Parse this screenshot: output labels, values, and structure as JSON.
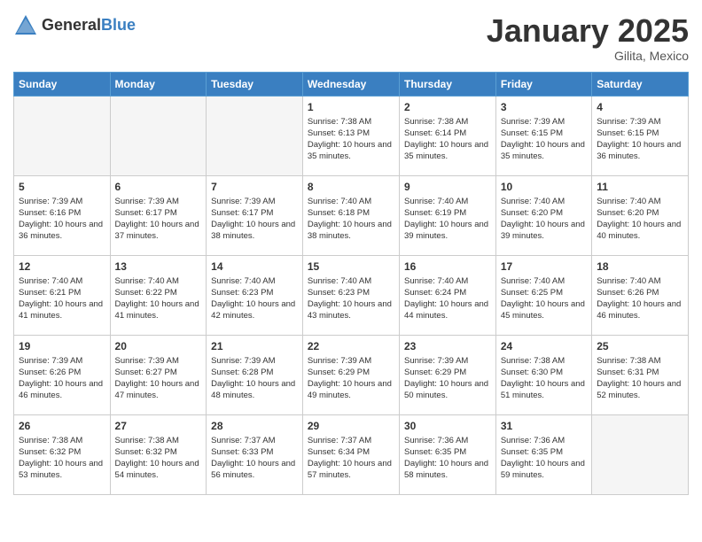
{
  "header": {
    "logo_general": "General",
    "logo_blue": "Blue",
    "month_year": "January 2025",
    "location": "Gilita, Mexico"
  },
  "days_of_week": [
    "Sunday",
    "Monday",
    "Tuesday",
    "Wednesday",
    "Thursday",
    "Friday",
    "Saturday"
  ],
  "weeks": [
    [
      {
        "day": "",
        "sunrise": "",
        "sunset": "",
        "daylight": ""
      },
      {
        "day": "",
        "sunrise": "",
        "sunset": "",
        "daylight": ""
      },
      {
        "day": "",
        "sunrise": "",
        "sunset": "",
        "daylight": ""
      },
      {
        "day": "1",
        "sunrise": "Sunrise: 7:38 AM",
        "sunset": "Sunset: 6:13 PM",
        "daylight": "Daylight: 10 hours and 35 minutes."
      },
      {
        "day": "2",
        "sunrise": "Sunrise: 7:38 AM",
        "sunset": "Sunset: 6:14 PM",
        "daylight": "Daylight: 10 hours and 35 minutes."
      },
      {
        "day": "3",
        "sunrise": "Sunrise: 7:39 AM",
        "sunset": "Sunset: 6:15 PM",
        "daylight": "Daylight: 10 hours and 35 minutes."
      },
      {
        "day": "4",
        "sunrise": "Sunrise: 7:39 AM",
        "sunset": "Sunset: 6:15 PM",
        "daylight": "Daylight: 10 hours and 36 minutes."
      }
    ],
    [
      {
        "day": "5",
        "sunrise": "Sunrise: 7:39 AM",
        "sunset": "Sunset: 6:16 PM",
        "daylight": "Daylight: 10 hours and 36 minutes."
      },
      {
        "day": "6",
        "sunrise": "Sunrise: 7:39 AM",
        "sunset": "Sunset: 6:17 PM",
        "daylight": "Daylight: 10 hours and 37 minutes."
      },
      {
        "day": "7",
        "sunrise": "Sunrise: 7:39 AM",
        "sunset": "Sunset: 6:17 PM",
        "daylight": "Daylight: 10 hours and 38 minutes."
      },
      {
        "day": "8",
        "sunrise": "Sunrise: 7:40 AM",
        "sunset": "Sunset: 6:18 PM",
        "daylight": "Daylight: 10 hours and 38 minutes."
      },
      {
        "day": "9",
        "sunrise": "Sunrise: 7:40 AM",
        "sunset": "Sunset: 6:19 PM",
        "daylight": "Daylight: 10 hours and 39 minutes."
      },
      {
        "day": "10",
        "sunrise": "Sunrise: 7:40 AM",
        "sunset": "Sunset: 6:20 PM",
        "daylight": "Daylight: 10 hours and 39 minutes."
      },
      {
        "day": "11",
        "sunrise": "Sunrise: 7:40 AM",
        "sunset": "Sunset: 6:20 PM",
        "daylight": "Daylight: 10 hours and 40 minutes."
      }
    ],
    [
      {
        "day": "12",
        "sunrise": "Sunrise: 7:40 AM",
        "sunset": "Sunset: 6:21 PM",
        "daylight": "Daylight: 10 hours and 41 minutes."
      },
      {
        "day": "13",
        "sunrise": "Sunrise: 7:40 AM",
        "sunset": "Sunset: 6:22 PM",
        "daylight": "Daylight: 10 hours and 41 minutes."
      },
      {
        "day": "14",
        "sunrise": "Sunrise: 7:40 AM",
        "sunset": "Sunset: 6:23 PM",
        "daylight": "Daylight: 10 hours and 42 minutes."
      },
      {
        "day": "15",
        "sunrise": "Sunrise: 7:40 AM",
        "sunset": "Sunset: 6:23 PM",
        "daylight": "Daylight: 10 hours and 43 minutes."
      },
      {
        "day": "16",
        "sunrise": "Sunrise: 7:40 AM",
        "sunset": "Sunset: 6:24 PM",
        "daylight": "Daylight: 10 hours and 44 minutes."
      },
      {
        "day": "17",
        "sunrise": "Sunrise: 7:40 AM",
        "sunset": "Sunset: 6:25 PM",
        "daylight": "Daylight: 10 hours and 45 minutes."
      },
      {
        "day": "18",
        "sunrise": "Sunrise: 7:40 AM",
        "sunset": "Sunset: 6:26 PM",
        "daylight": "Daylight: 10 hours and 46 minutes."
      }
    ],
    [
      {
        "day": "19",
        "sunrise": "Sunrise: 7:39 AM",
        "sunset": "Sunset: 6:26 PM",
        "daylight": "Daylight: 10 hours and 46 minutes."
      },
      {
        "day": "20",
        "sunrise": "Sunrise: 7:39 AM",
        "sunset": "Sunset: 6:27 PM",
        "daylight": "Daylight: 10 hours and 47 minutes."
      },
      {
        "day": "21",
        "sunrise": "Sunrise: 7:39 AM",
        "sunset": "Sunset: 6:28 PM",
        "daylight": "Daylight: 10 hours and 48 minutes."
      },
      {
        "day": "22",
        "sunrise": "Sunrise: 7:39 AM",
        "sunset": "Sunset: 6:29 PM",
        "daylight": "Daylight: 10 hours and 49 minutes."
      },
      {
        "day": "23",
        "sunrise": "Sunrise: 7:39 AM",
        "sunset": "Sunset: 6:29 PM",
        "daylight": "Daylight: 10 hours and 50 minutes."
      },
      {
        "day": "24",
        "sunrise": "Sunrise: 7:38 AM",
        "sunset": "Sunset: 6:30 PM",
        "daylight": "Daylight: 10 hours and 51 minutes."
      },
      {
        "day": "25",
        "sunrise": "Sunrise: 7:38 AM",
        "sunset": "Sunset: 6:31 PM",
        "daylight": "Daylight: 10 hours and 52 minutes."
      }
    ],
    [
      {
        "day": "26",
        "sunrise": "Sunrise: 7:38 AM",
        "sunset": "Sunset: 6:32 PM",
        "daylight": "Daylight: 10 hours and 53 minutes."
      },
      {
        "day": "27",
        "sunrise": "Sunrise: 7:38 AM",
        "sunset": "Sunset: 6:32 PM",
        "daylight": "Daylight: 10 hours and 54 minutes."
      },
      {
        "day": "28",
        "sunrise": "Sunrise: 7:37 AM",
        "sunset": "Sunset: 6:33 PM",
        "daylight": "Daylight: 10 hours and 56 minutes."
      },
      {
        "day": "29",
        "sunrise": "Sunrise: 7:37 AM",
        "sunset": "Sunset: 6:34 PM",
        "daylight": "Daylight: 10 hours and 57 minutes."
      },
      {
        "day": "30",
        "sunrise": "Sunrise: 7:36 AM",
        "sunset": "Sunset: 6:35 PM",
        "daylight": "Daylight: 10 hours and 58 minutes."
      },
      {
        "day": "31",
        "sunrise": "Sunrise: 7:36 AM",
        "sunset": "Sunset: 6:35 PM",
        "daylight": "Daylight: 10 hours and 59 minutes."
      },
      {
        "day": "",
        "sunrise": "",
        "sunset": "",
        "daylight": ""
      }
    ]
  ]
}
